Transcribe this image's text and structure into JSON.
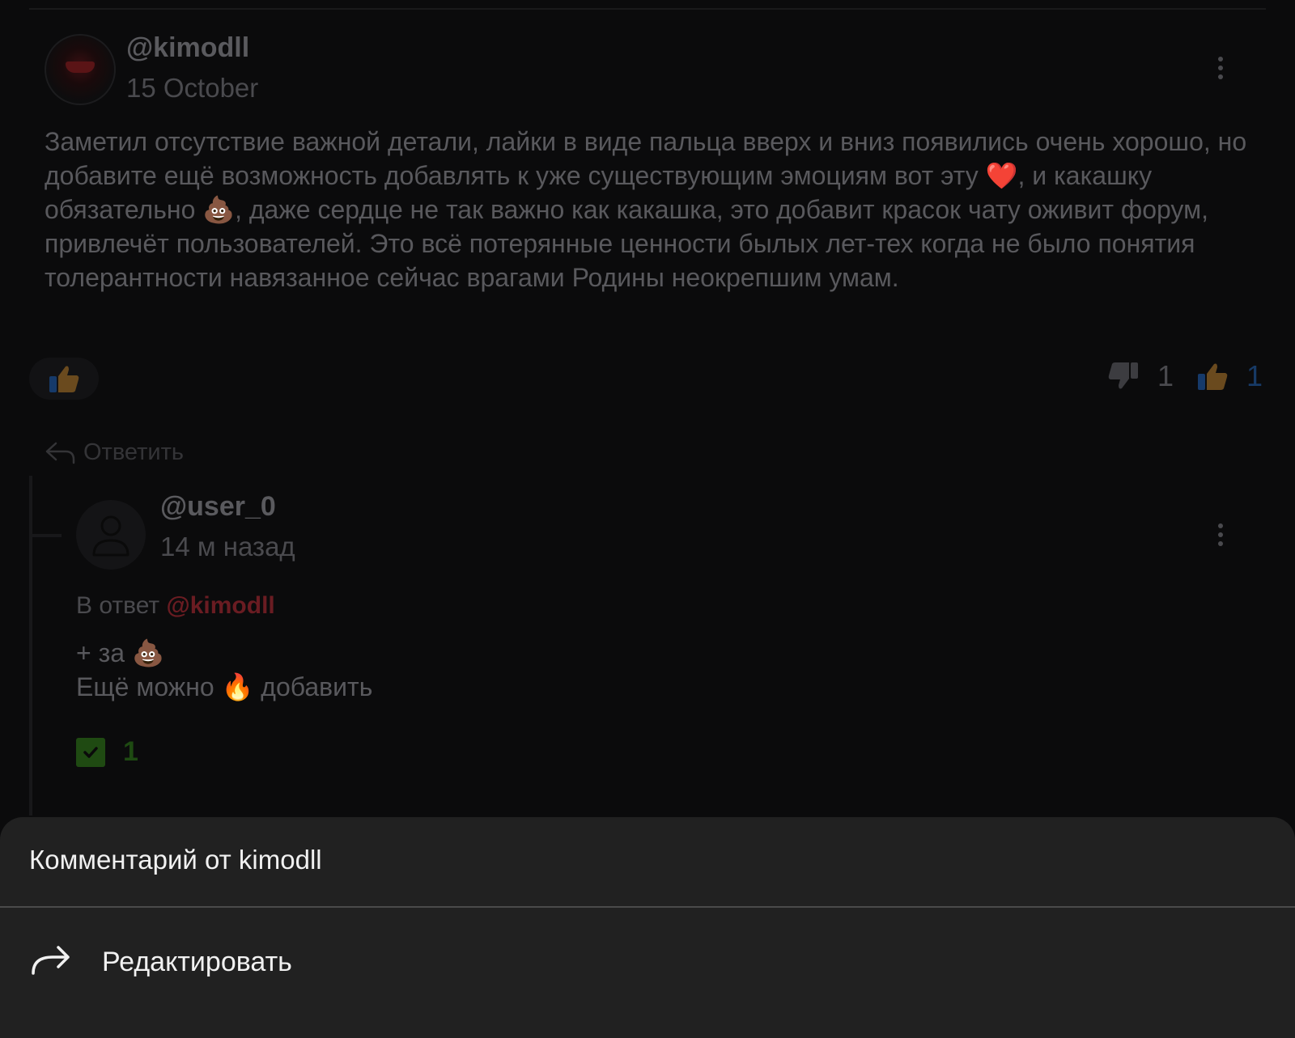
{
  "main_comment": {
    "author": "@kimodll",
    "date": "15 October",
    "text": "Заметил отсутствие важной детали, лайки в виде пальца вверх и вниз появились очень хорошо, но добавите ещё возможность добавлять к уже существующим эмоциям вот эту ❤️, и какашку обязательно 💩, даже сердце не так важно как какашка, это добавит красок чату оживит форум, привлечёт пользователей. Это всё потерянные ценности былых лет-тех когда не было понятия толерантности навязанное сейчас врагами Родины неокрепшим умам.",
    "dislike_count": "1",
    "like_count": "1",
    "reply_label": "Ответить"
  },
  "reply_comment": {
    "author": "@user_0",
    "date": "14 м назад",
    "in_reply_prefix": "В ответ",
    "in_reply_mention": "@kimodll",
    "line1": "+ за 💩",
    "line2": "Ещё можно 🔥 добавить",
    "check_count": "1"
  },
  "bottom_sheet": {
    "title": "Комментарий от kimodll",
    "items": [
      {
        "label": "Редактировать",
        "icon": "share-arrow-icon"
      }
    ]
  },
  "colors": {
    "background": "#0b0b0c",
    "sheet": "#212121",
    "like_blue": "#173a66",
    "mention_red": "#6a1c22",
    "check_green": "#1f4a12"
  }
}
